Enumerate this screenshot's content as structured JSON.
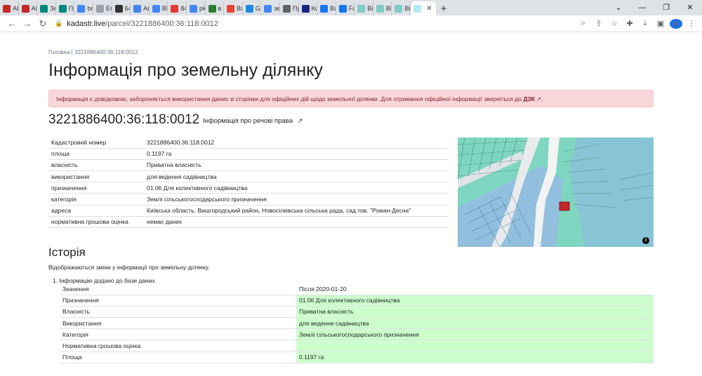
{
  "browser": {
    "tabs": [
      {
        "label": "AL",
        "color": "#c62828"
      },
      {
        "label": "AL",
        "color": "#c62828"
      },
      {
        "label": "Зе",
        "color": "#00897b"
      },
      {
        "label": "Пр",
        "color": "#00897b"
      },
      {
        "label": "bm",
        "color": "#4285f4"
      },
      {
        "label": "Em",
        "color": "#9aa0a6"
      },
      {
        "label": "64",
        "color": "#333333"
      },
      {
        "label": "Ав",
        "color": "#4285f4"
      },
      {
        "label": "BM",
        "color": "#4285f4"
      },
      {
        "label": "84",
        "color": "#e53935"
      },
      {
        "label": "pk",
        "color": "#4285f4"
      },
      {
        "label": "в",
        "color": "#2e7d32"
      },
      {
        "label": "Вх",
        "color": "#ea4335"
      },
      {
        "label": "GI",
        "color": "#1e88e5"
      },
      {
        "label": "зе",
        "color": "#4285f4"
      },
      {
        "label": "Пр",
        "color": "#5f6368"
      },
      {
        "label": "Ко",
        "color": "#1a237e"
      },
      {
        "label": "Ва",
        "color": "#1877f2"
      },
      {
        "label": "Fa",
        "color": "#1877f2"
      },
      {
        "label": "Ві",
        "color": "#80cbc4"
      },
      {
        "label": "Ві",
        "color": "#80cbc4"
      },
      {
        "label": "Ві",
        "color": "#80cbc4"
      }
    ],
    "active_tab_icon": "map-icon",
    "url_host": "kadastr.live",
    "url_path": "/parcel/3221886400:36:118:0012",
    "profile_initial": "B"
  },
  "breadcrumb": {
    "home": "Головна",
    "separator": "|",
    "current": "3221886400:36:118:0012"
  },
  "title": "Інформація про земельну ділянку",
  "alert": {
    "text": "Інформація є довідковою, забороняється використання даних зі сторінки для офіційних дій щодо земельної ділянки. Для отримання офіційної інформації зверніться до ",
    "link": "ДЗК"
  },
  "parcel": {
    "number": "3221886400:36:118:0012",
    "rights_link": "Інформація про речові права"
  },
  "info_rows": [
    {
      "key": "Кадастровий номер",
      "value": "3221886400:36:118:0012"
    },
    {
      "key": "площа",
      "value": "0.1197 га"
    },
    {
      "key": "власність",
      "value": "Приватна власність"
    },
    {
      "key": "використання",
      "value": "для ведення садівництва"
    },
    {
      "key": "призначення",
      "value": "01.06 Для колективного садівництва"
    },
    {
      "key": "категорія",
      "value": "Землі сільськогосподарського призначення"
    },
    {
      "key": "адреса",
      "value": "Київська область, Вишгородський район, Новосілківська сільська рада, сад.тов. \"Роман-Десна\""
    },
    {
      "key": "нормативна грошова оцінка",
      "value": "немає даних"
    }
  ],
  "history": {
    "title": "Історія",
    "description": "Відображаються зміни у інформації про земельну ділянку.",
    "item_number": "1.",
    "item_title": "Інформацію додано до бази даних",
    "header": {
      "key": "Значення",
      "value": "Після 2020-01-20"
    },
    "rows": [
      {
        "key": "Призначення",
        "value": "01.06 Для колективного садівництва"
      },
      {
        "key": "Власність",
        "value": "Приватна власність"
      },
      {
        "key": "Використання",
        "value": "для ведення садівництва"
      },
      {
        "key": "Категорія",
        "value": "Землі сільськогосподарського призначення"
      },
      {
        "key": "Нормативна грошова оцінка",
        "value": ""
      },
      {
        "key": "Площа",
        "value": "0.1197 га"
      }
    ]
  },
  "colors": {
    "alert_bg": "#f8d7da",
    "history_highlight": "#ccffcc",
    "map_parcel": "#c62828",
    "map_water": "#87c5d6",
    "map_land": "#7fd6c0"
  }
}
